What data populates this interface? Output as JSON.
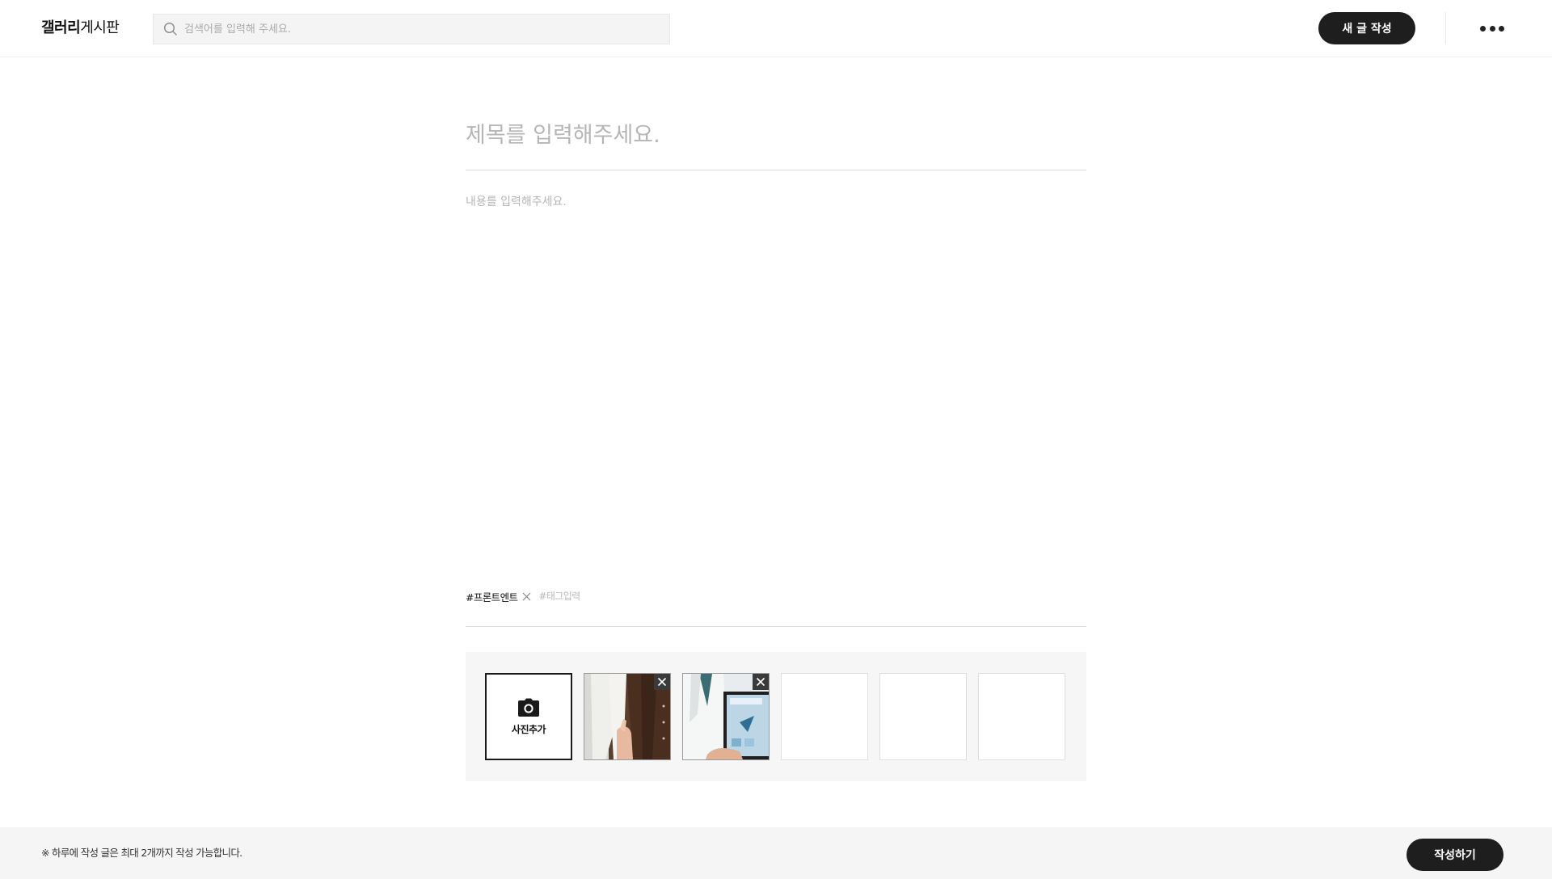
{
  "header": {
    "brand_bold": "갤러리",
    "brand_light": "게시판",
    "search_placeholder": "검색어를 입력해 주세요.",
    "new_post_label": "새 글 작성",
    "more_icon": "more-horizontal-icon"
  },
  "editor": {
    "title_placeholder": "제목를 입력해주세요.",
    "title_value": "",
    "content_placeholder": "내용를 입력해주세요.",
    "content_value": ""
  },
  "tags": {
    "items": [
      {
        "label": "#프론트엔트"
      }
    ],
    "input_placeholder": "#태그입력",
    "input_value": ""
  },
  "photos": {
    "add_label": "사진추가",
    "add_icon": "camera-icon",
    "uploaded": [
      {
        "description": "photo-coat-hand",
        "remove_icon": "close-icon"
      },
      {
        "description": "photo-doctor-tablet",
        "remove_icon": "close-icon"
      }
    ],
    "empty_slots": 3
  },
  "footer": {
    "notice": "※ 하루에 작성 글은 최대 2개까지 작성 가능합니다.",
    "submit_label": "작성하기"
  },
  "colors": {
    "primary_button": "#1e1e1e",
    "footer_bg": "#f5f5f5",
    "panel_bg": "#f6f6f6",
    "placeholder": "#b5b5b5"
  }
}
